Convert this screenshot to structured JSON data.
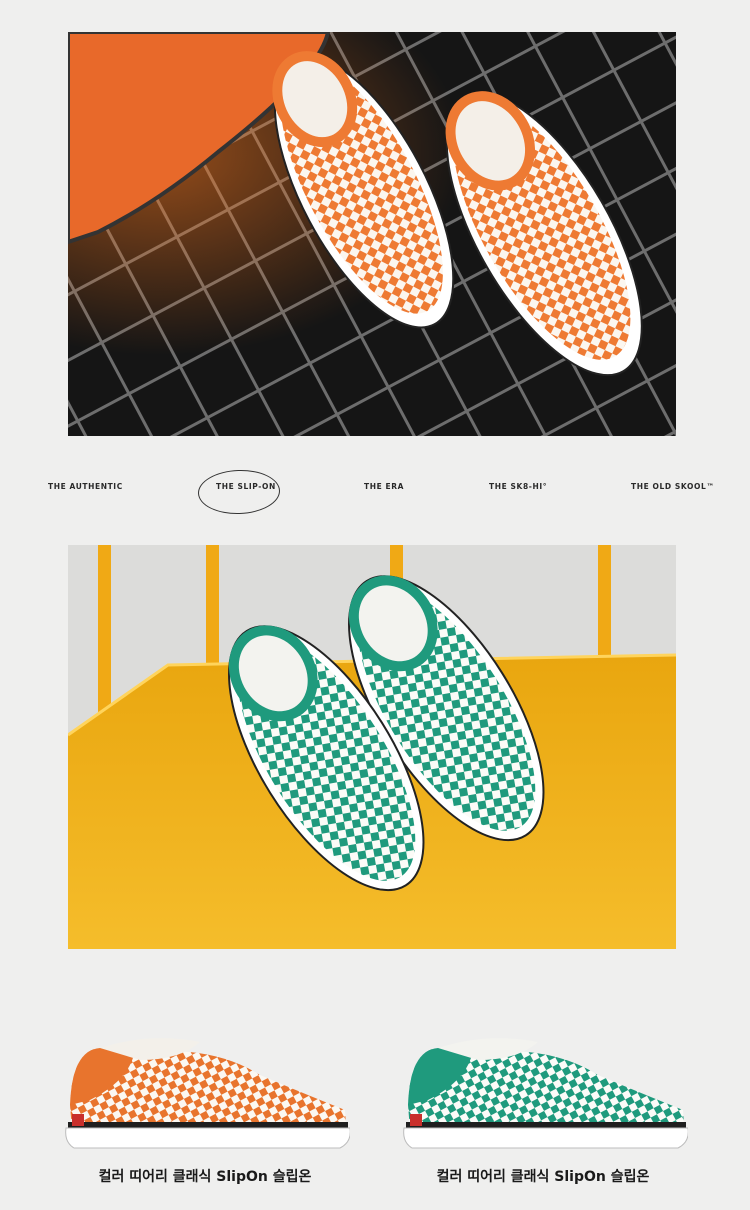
{
  "model_nav": {
    "items": [
      {
        "label": "THE AUTHENTIC",
        "active": false
      },
      {
        "label": "THE SLIP-ON",
        "active": true
      },
      {
        "label": "THE ERA",
        "active": false
      },
      {
        "label": "THE SK8-HI°",
        "active": false
      },
      {
        "label": "THE OLD SKOOL™",
        "active": false
      }
    ]
  },
  "photos": {
    "top": {
      "subject": "orange checkerboard slip-on pair on black tile floor"
    },
    "middle": {
      "subject": "green checkerboard slip-on pair on yellow shelf"
    }
  },
  "products": [
    {
      "name": "컬러 띠어리 클래식 SlipOn 슬립온",
      "color": "#e8742d"
    },
    {
      "name": "컬러 띠어리 클래식 SlipOn 슬립온",
      "color": "#1f9a7d"
    }
  ],
  "colors": {
    "page_background": "#efefee",
    "orange_accent": "#e8742d",
    "green_accent": "#1f9a7d",
    "yellow_surface": "#f2b21b",
    "tile_black": "#141414"
  }
}
